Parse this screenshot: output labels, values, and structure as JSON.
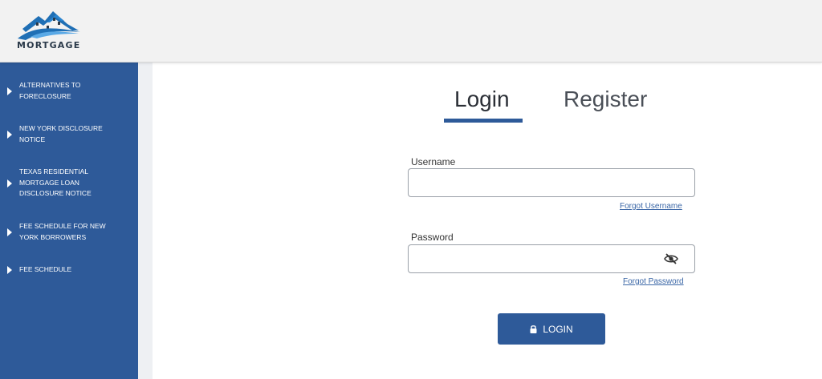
{
  "logo": {
    "text": "MORTGAGE"
  },
  "sidebar": {
    "items": [
      {
        "label": "ALTERNATIVES TO FORECLOSURE"
      },
      {
        "label": "NEW YORK DISCLOSURE NOTICE"
      },
      {
        "label": "TEXAS RESIDENTIAL MORTGAGE LOAN DISCLOSURE NOTICE"
      },
      {
        "label": "FEE SCHEDULE FOR NEW YORK BORROWERS"
      },
      {
        "label": "FEE SCHEDULE"
      }
    ]
  },
  "tabs": {
    "login": "Login",
    "register": "Register",
    "active": "login"
  },
  "form": {
    "username_label": "Username",
    "username_value": "",
    "forgot_username": "Forgot Username",
    "password_label": "Password",
    "password_value": "",
    "forgot_password": "Forgot Password",
    "login_button": "LOGIN"
  },
  "colors": {
    "brand": "#2e5a99",
    "header_bg": "#f2f2f2",
    "link": "#3a66a6"
  },
  "icons": [
    "logo-house-icon",
    "play-triangle-icon",
    "eye-off-icon",
    "lock-icon"
  ]
}
